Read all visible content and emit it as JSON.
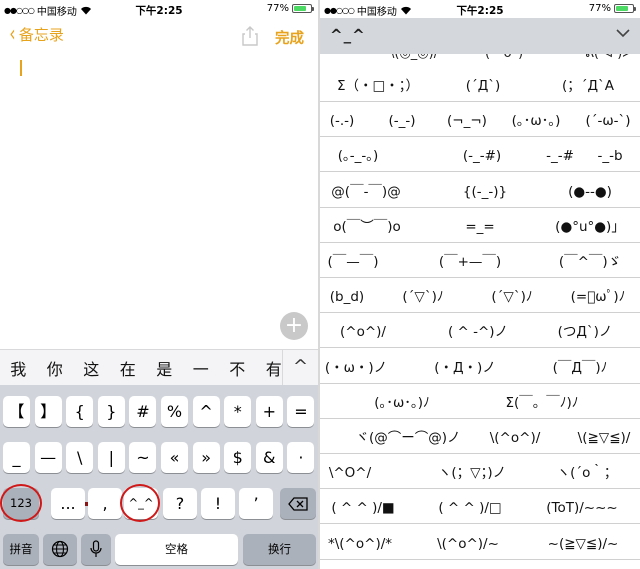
{
  "left_screen": {
    "status": {
      "carrier": "中国移动",
      "time": "下午2:25",
      "battery": "77%",
      "battery_level": 0.77
    },
    "nav": {
      "back_label": "备忘录",
      "done_label": "完成"
    },
    "candidates": [
      "我",
      "你",
      "这",
      "在",
      "是",
      "一",
      "不",
      "有"
    ],
    "candidates_more": "^",
    "keyboard": {
      "row1": [
        "【",
        "】",
        "{",
        "}",
        "#",
        "%",
        "^",
        "*",
        "+",
        "="
      ],
      "row2": [
        "_",
        "—",
        "\\",
        "|",
        "~",
        "«",
        "»",
        "$",
        "&",
        "·"
      ],
      "row3": [
        "123",
        "...",
        ",",
        "^_^",
        "?",
        "!",
        "’"
      ],
      "row4": {
        "pinyin": "拼音",
        "space": "空格",
        "return": "换行"
      }
    },
    "colors": {
      "accent": "#e8a31d",
      "annotation": "#d01818"
    }
  },
  "right_screen": {
    "status": {
      "carrier": "中国移动",
      "time": "下午2:25",
      "battery": "77%",
      "battery_level": 0.77
    },
    "header": {
      "title": "^_^"
    },
    "partial_row": [
      "\\(◎_◎)/",
      "(′° ᴗ°)",
      "ᕕ( ᐛ )ᕗ"
    ],
    "rows": [
      [
        "Σ（・□・；）",
        "(´Д`)",
        "(；´Д`A"
      ],
      [
        "(-.-)",
        "(-_-)",
        "(¬_¬)",
        "(｡･ω･｡)",
        "(´-ω-`)"
      ],
      [
        "(｡-_-｡)",
        "(-_-#)",
        "-_-#",
        "-_-b"
      ],
      [
        "@(￣-￣)@",
        "{(-_-)}",
        "(●--●)"
      ],
      [
        "o(￣︶￣)o",
        "=_=",
        "(●°u°●)」"
      ],
      [
        "(￣—￣)",
        "(￣+—￣)",
        "(￣^￣)ゞ"
      ],
      [
        "(b_d)",
        "(´▽`)ﾉ",
        "(´▽`)ﾉ",
        "(=ﾟωﾟ)ﾉ"
      ],
      [
        "(^o^)/",
        "( ^ -^)ノ",
        "(つД`)ノ"
      ],
      [
        "(・ω・)ノ",
        "(・Д・)ノ",
        "(￣Д￣)ﾉ"
      ],
      [
        "(｡･ω･｡)ﾉ",
        "Σ(￣。￣ﾉ)ﾉ"
      ],
      [
        "ヾ(@⌒ー⌒@)ノ",
        "\\(^o^)/",
        "\\(≧▽≦)/"
      ],
      [
        "\\^O^/",
        "ヽ(；▽；)ノ",
        "ヽ(´o｀；"
      ],
      [
        "( ^ ^ )/■",
        "( ^ ^ )/□",
        "(ToT)/~~~"
      ],
      [
        "*\\(^o^)/*",
        "\\(^o^)/~",
        "~(≧▽≦)/~"
      ]
    ]
  }
}
